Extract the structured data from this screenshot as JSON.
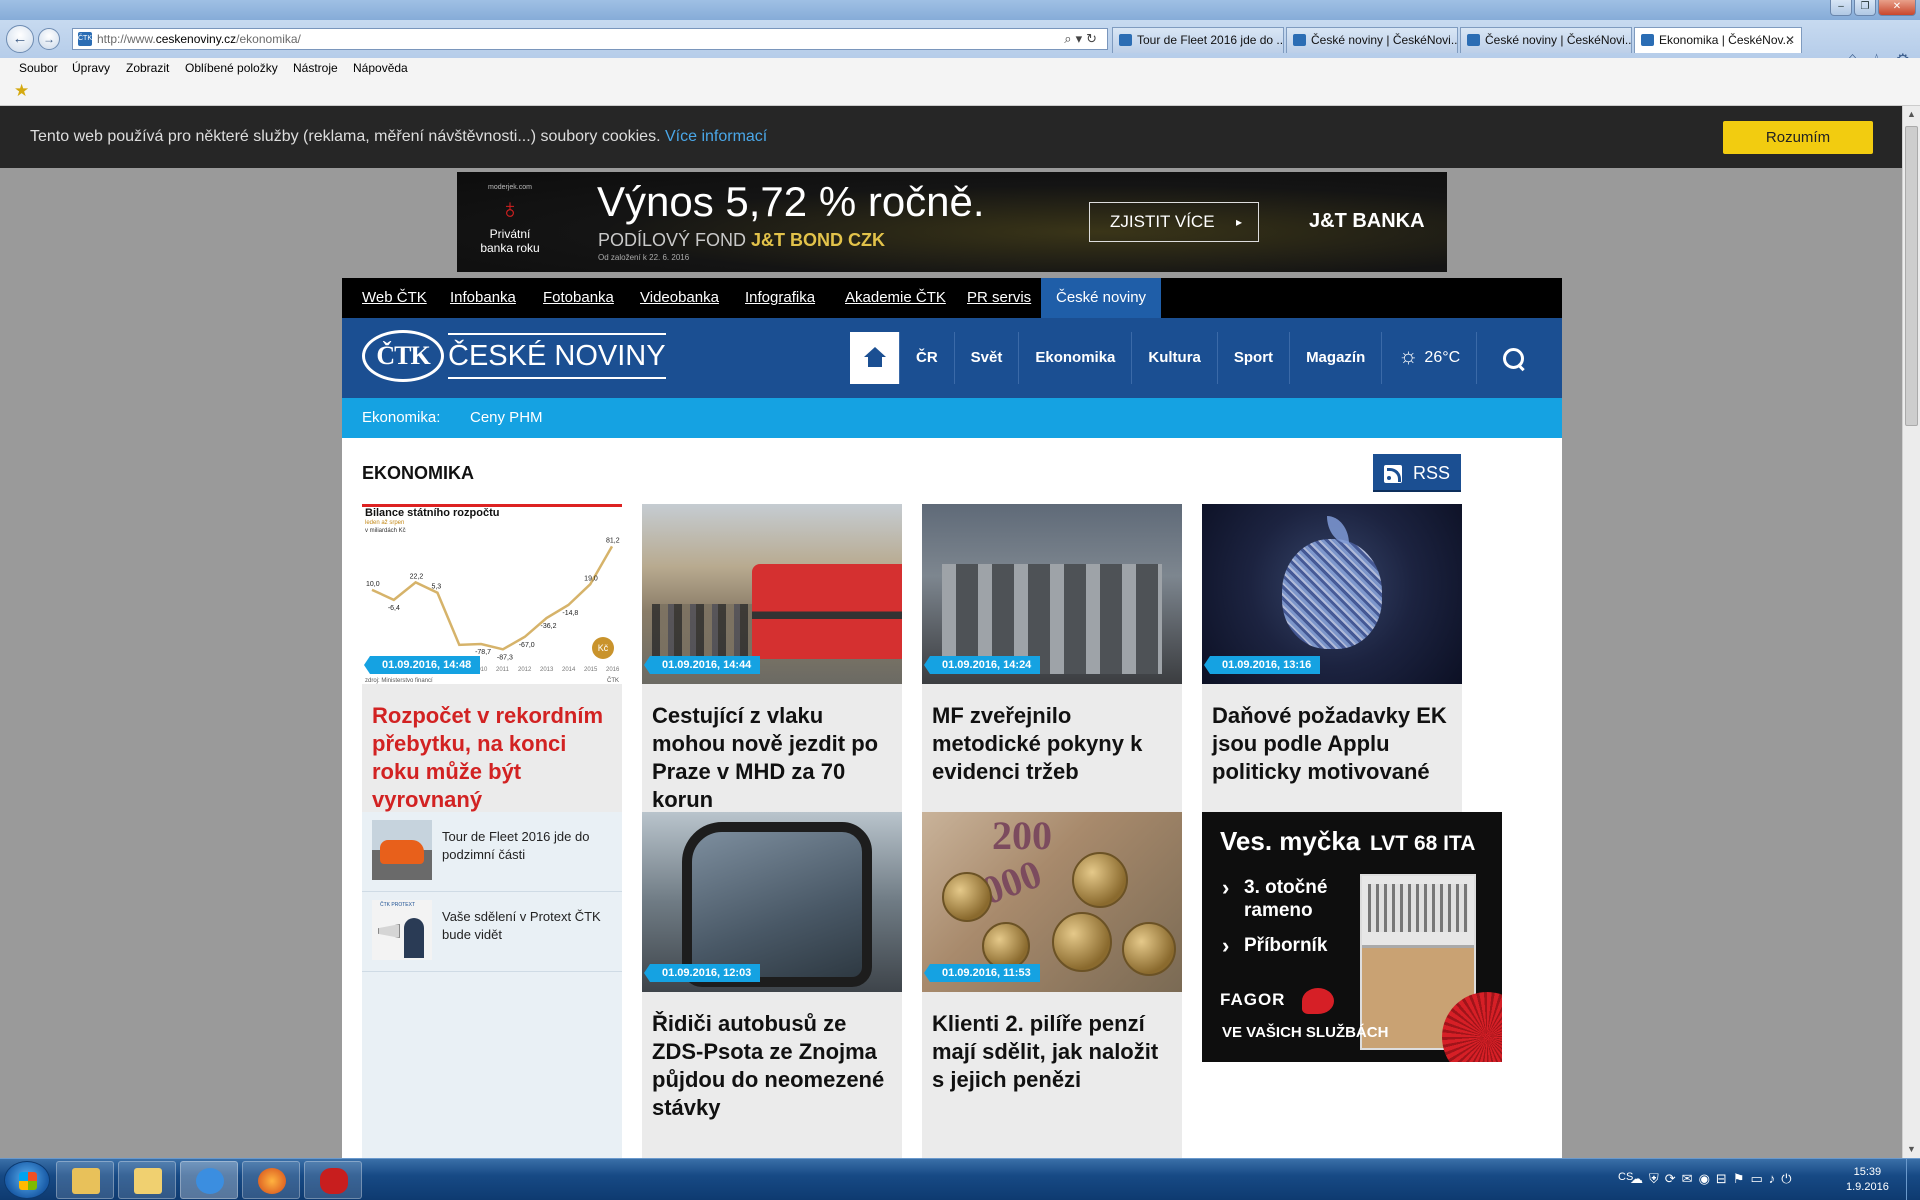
{
  "browser": {
    "url_prefix": "http://www.",
    "url_host": "ceskenoviny.cz",
    "url_path": "/ekonomika/",
    "tabs": [
      {
        "label": "Tour de Fleet 2016 jde do ..."
      },
      {
        "label": "České noviny | ČeskéNovi..."
      },
      {
        "label": "České noviny | ČeskéNovi..."
      },
      {
        "label": "Ekonomika | ČeskéNov..."
      }
    ],
    "menu": [
      "Soubor",
      "Úpravy",
      "Zobrazit",
      "Oblíbené položky",
      "Nástroje",
      "Nápověda"
    ]
  },
  "cookie": {
    "text": "Tento web používá pro některé služby (reklama, měření návštěvnosti...) soubory cookies.",
    "link": "Více informací",
    "button": "Rozumím"
  },
  "ad_top": {
    "logo_small": "moderjek.com",
    "logo_text": "Privátní banka roku",
    "headline": "Výnos 5,72 % ročně.",
    "sub_prefix": "PODÍLOVÝ FOND",
    "sub_fund": "J&T BOND CZK",
    "note": "Od založení k 22. 6. 2016",
    "cta": "ZJISTIT VÍCE",
    "brand": "J&T BANKA"
  },
  "topnav": [
    "Web ČTK",
    "Infobanka",
    "Fotobanka",
    "Videobanka",
    "Infografika",
    "Akademie ČTK",
    "PR servis",
    "České noviny"
  ],
  "header": {
    "logo_mark": "ČTK",
    "logo_name": "ČESKÉ NOVINY",
    "menu": [
      "ČR",
      "Svět",
      "Ekonomika",
      "Kultura",
      "Sport",
      "Magazín"
    ],
    "weather": "26°C"
  },
  "subnav": {
    "label": "Ekonomika:",
    "item": "Ceny PHM"
  },
  "section": {
    "title": "EKONOMIKA",
    "rss": "RSS"
  },
  "chart_thumb": {
    "title": "Bilance státního rozpočtu",
    "sub1": "leden až srpen",
    "sub2": "v miliardách Kč"
  },
  "chart_data": {
    "type": "line",
    "title": "Bilance státního rozpočtu",
    "subtitle": "leden až srpen",
    "ylabel": "v miliardách Kč",
    "x": [
      "2006",
      "2007",
      "2008",
      "2009",
      "2010",
      "2011",
      "2012",
      "2013",
      "2014",
      "2015",
      "2016"
    ],
    "values": [
      10.0,
      -6.4,
      22.2,
      5.3,
      -80.0,
      -78.7,
      -87.3,
      -67.0,
      -36.2,
      -14.8,
      19.0,
      81.2
    ],
    "labels": [
      "10,0",
      "-6,4",
      "22,2",
      "5,3",
      "-78,7",
      "-87,3",
      "-67,0",
      "-36,2",
      "-14,8",
      "19,0",
      "81,2"
    ],
    "tick_labels": [
      "2010",
      "2011",
      "2012",
      "2013",
      "2014",
      "2015",
      "2016"
    ],
    "source": "zdroj: Ministerstvo financí",
    "credit": "ČTK",
    "color": "#d6b36a"
  },
  "cards": [
    {
      "date": "01.09.2016, 14:48",
      "title": "Rozpočet v rekordním přebytku, na konci roku může být vyrovnaný"
    },
    {
      "date": "01.09.2016, 14:44",
      "title": "Cestující z vlaku mohou nově jezdit po Praze v MHD za 70 korun"
    },
    {
      "date": "01.09.2016, 14:24",
      "title": "MF zveřejnilo metodické pokyny k evidenci tržeb"
    },
    {
      "date": "01.09.2016, 13:16",
      "title": "Daňové požadavky EK jsou podle Applu politicky motivované"
    },
    {
      "date": "01.09.2016, 12:03",
      "title": "Řidiči autobusů ze ZDS-Psota ze Znojma půjdou do neomezené stávky"
    },
    {
      "date": "01.09.2016, 11:53",
      "title": "Klienti 2. pilíře penzí mají sdělit, jak naložit s jejich penězi"
    }
  ],
  "side_list": [
    {
      "text": "Tour de Fleet 2016 jde do podzimní části"
    },
    {
      "text": "Vaše sdělení v Protext ČTK bude vidět"
    }
  ],
  "ad_side": {
    "title": "Ves. myčka",
    "model": "LVT 68 ITA",
    "bullet1": "3. otočné rameno",
    "bullet2": "Příborník",
    "brand": "FAGOR",
    "slogan": "VE VAŠICH SLUŽBÁCH"
  },
  "taskbar": {
    "lang": "CS",
    "time": "15:39",
    "date": "1.9.2016"
  },
  "colors": {
    "brand_blue": "#1b4f92",
    "accent_cyan": "#15a2e2",
    "headline_red": "#d22222",
    "cookie_button": "#f2cc10"
  }
}
